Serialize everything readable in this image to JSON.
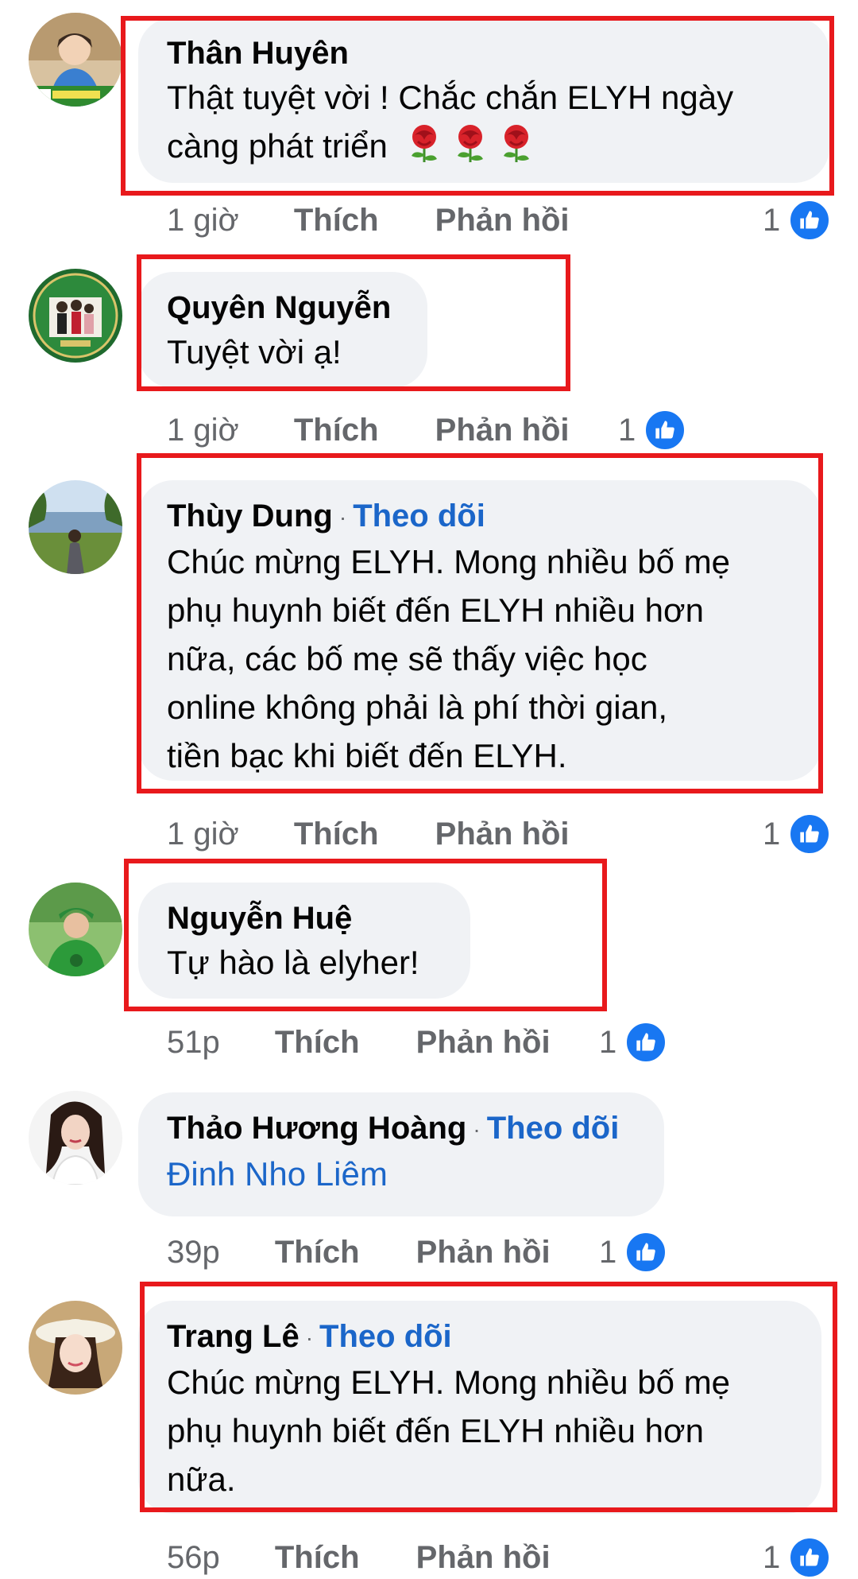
{
  "comments": [
    {
      "author": "Thân Huyên",
      "lines": [
        "Thật tuyệt vời ! Chắc chắn ELYH ngày",
        "càng phát triển"
      ],
      "emoji": [
        "rose-icon",
        "rose-icon",
        "rose-icon"
      ],
      "time": "1 giờ",
      "like_label": "Thích",
      "reply_label": "Phản hồi",
      "reaction_count": "1"
    },
    {
      "author": "Quyên Nguyễn",
      "lines": [
        "Tuyệt vời ạ!"
      ],
      "time": "1 giờ",
      "like_label": "Thích",
      "reply_label": "Phản hồi",
      "reaction_count": "1"
    },
    {
      "author": "Thùy Dung",
      "dot": "·",
      "follow_label": "Theo dõi",
      "lines": [
        "Chúc mừng ELYH. Mong nhiều bố mẹ",
        "phụ huynh biết đến ELYH nhiều hơn",
        "nữa, các bố mẹ sẽ thấy việc học",
        "online không phải là phí thời gian,",
        "tiền bạc khi biết đến ELYH."
      ],
      "time": "1 giờ",
      "like_label": "Thích",
      "reply_label": "Phản hồi",
      "reaction_count": "1"
    },
    {
      "author": "Nguyễn Huệ",
      "lines": [
        "Tự hào là elyher!"
      ],
      "time": "51p",
      "like_label": "Thích",
      "reply_label": "Phản hồi",
      "reaction_count": "1"
    },
    {
      "author": "Thảo Hương Hoàng",
      "dot": "·",
      "follow_label": "Theo dõi",
      "mention": "Đinh Nho Liêm",
      "time": "39p",
      "like_label": "Thích",
      "reply_label": "Phản hồi",
      "reaction_count": "1"
    },
    {
      "author": "Trang Lê",
      "dot": "·",
      "follow_label": "Theo dõi",
      "lines": [
        "Chúc mừng ELYH. Mong nhiều bố mẹ",
        "phụ huynh biết đến ELYH nhiều hơn",
        "nữa."
      ],
      "time": "56p",
      "like_label": "Thích",
      "reply_label": "Phản hồi",
      "reaction_count": "1"
    }
  ],
  "colors": {
    "bubble": "#f0f2f5",
    "link_blue": "#1b66c9",
    "like_blue": "#1877f2",
    "highlight_red": "#e8191c",
    "meta_gray": "#65676b"
  }
}
